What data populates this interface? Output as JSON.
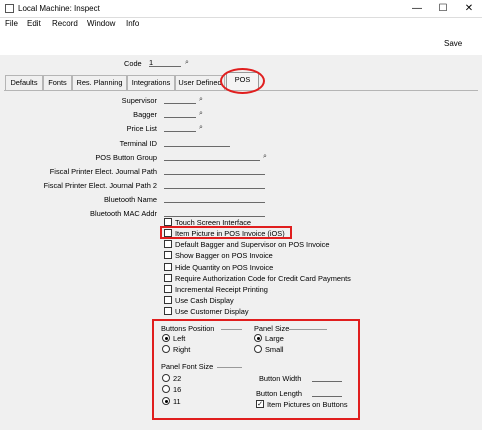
{
  "window": {
    "title": "Local Machine: Inspect",
    "minimize": "—",
    "maximize": "☐",
    "close": "✕"
  },
  "menu": [
    "File",
    "Edit",
    "Record",
    "Window",
    "Info"
  ],
  "toolbar": {
    "save": "Save"
  },
  "header": {
    "code_label": "Code",
    "code_value": "1"
  },
  "tabs": [
    "Defaults",
    "Fonts",
    "Res. Planning",
    "Integrations",
    "User Defined",
    "POS"
  ],
  "fields": {
    "supervisor": "Supervisor",
    "bagger": "Bagger",
    "price_list": "Price List",
    "terminal_id": "Terminal ID",
    "pos_button_group": "POS Button Group",
    "fiscal1": "Fiscal Printer Elect. Journal Path",
    "fiscal2": "Fiscal Printer Elect. Journal Path 2",
    "bt_name": "Bluetooth Name",
    "bt_mac": "Bluetooth MAC Addr"
  },
  "checkboxes": [
    {
      "label": "Touch Screen Interface",
      "checked": false
    },
    {
      "label": "Item Picture in POS Invoice (iOS)",
      "checked": false
    },
    {
      "label": "Default Bagger and Supervisor on POS Invoice",
      "checked": false
    },
    {
      "label": "Show Bagger on POS Invoice",
      "checked": false
    },
    {
      "label": "Hide Quantity on POS Invoice",
      "checked": false
    },
    {
      "label": "Require Authorization Code for Credit Card Payments",
      "checked": false
    },
    {
      "label": "Incremental Receipt Printing",
      "checked": false
    },
    {
      "label": "Use Cash Display",
      "checked": false
    },
    {
      "label": "Use Customer Display",
      "checked": false
    }
  ],
  "buttons_position": {
    "label": "Buttons Position",
    "options": [
      "Left",
      "Right"
    ],
    "selected": "Left"
  },
  "panel_size": {
    "label": "Panel Size",
    "options": [
      "Large",
      "Small"
    ],
    "selected": "Large"
  },
  "panel_font_size": {
    "label": "Panel Font Size",
    "options": [
      "22",
      "16",
      "11"
    ],
    "selected": "11"
  },
  "button_width": "Button Width",
  "button_length": "Button Length",
  "item_pictures_on_buttons": {
    "label": "Item Pictures on Buttons",
    "checked": true,
    "mark": "✓"
  },
  "paste_icon": "⌕",
  "accent": "#e01e1e"
}
